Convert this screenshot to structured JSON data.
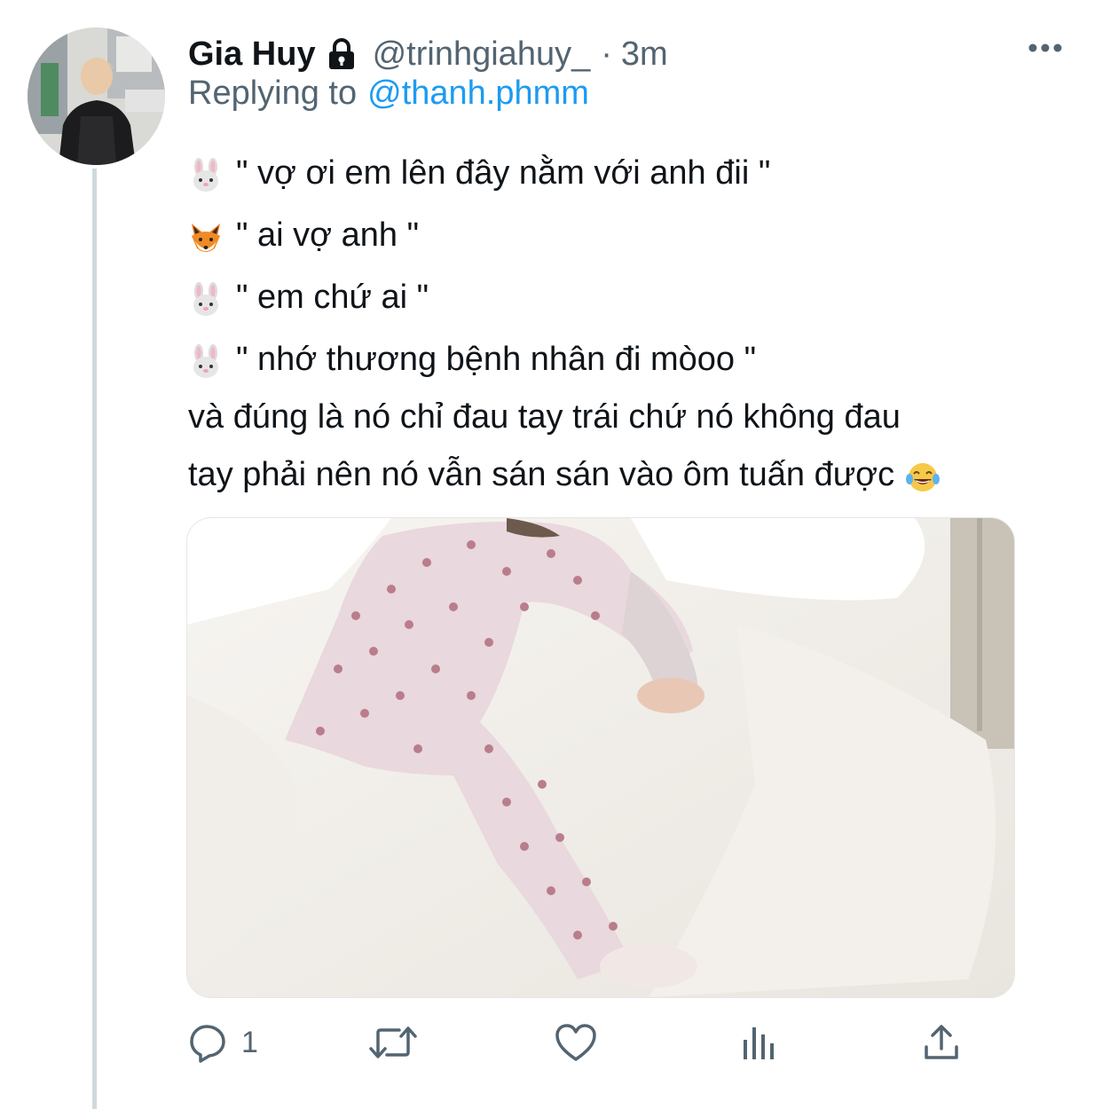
{
  "tweet": {
    "author": {
      "display_name": "Gia Huy",
      "handle": "@trinhgiahuy_",
      "protected_icon": "lock-icon"
    },
    "separator": "·",
    "time": "3m",
    "replying_to_prefix": "Replying to",
    "replying_to_handle": "@thanh.phmm",
    "lines": [
      {
        "emoji": "rabbit-face-emoji",
        "text": "\" vợ ơi em lên đây nằm với anh đii \""
      },
      {
        "emoji": "fox-face-emoji",
        "text": "\" ai vợ anh \""
      },
      {
        "emoji": "rabbit-face-emoji",
        "text": "\" em chứ ai \""
      },
      {
        "emoji": "rabbit-face-emoji",
        "text": "\" nhớ thương bệnh nhân đi mòoo \""
      },
      {
        "text": "và đúng là nó chỉ đau tay trái chứ nó không đau"
      },
      {
        "text": "tay phải nên nó vẫn sán sán vào ôm tuấn được",
        "trailing_emoji": "laughing-tears-emoji"
      }
    ],
    "media": {
      "alt_icon": "photo-person-in-pajamas-on-bed"
    },
    "actions": {
      "reply_count": "1",
      "icons": [
        "reply-icon",
        "retweet-icon",
        "like-icon",
        "views-icon",
        "share-icon"
      ]
    },
    "colors": {
      "primary_text": "#0f1419",
      "secondary_text": "#536471",
      "link": "#1d9bf0",
      "thread_line": "#cfd9de"
    }
  }
}
